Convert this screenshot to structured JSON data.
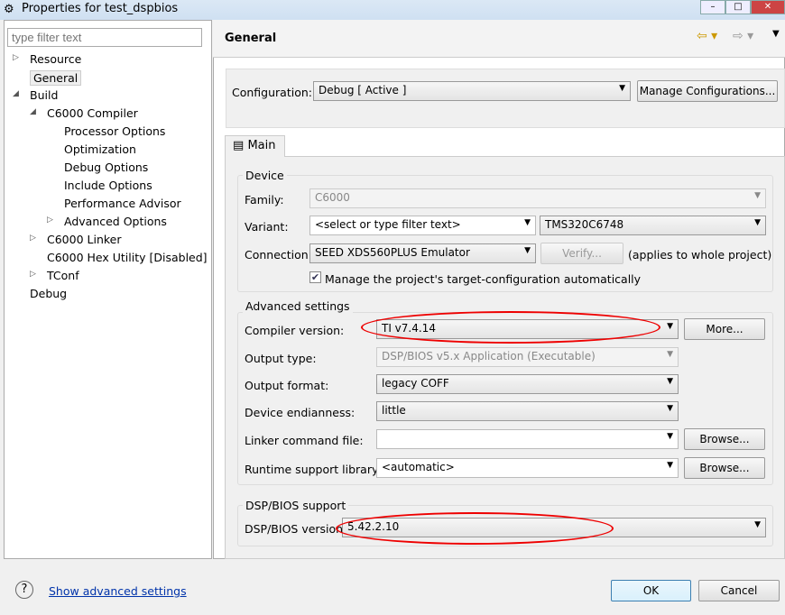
{
  "window": {
    "title": "Properties for test_dspbios"
  },
  "sidebar": {
    "filter_placeholder": "type filter text",
    "items": [
      {
        "label": "Resource",
        "level": 0,
        "expander": "collapsed"
      },
      {
        "label": "General",
        "level": 0,
        "selected": true
      },
      {
        "label": "Build",
        "level": 0,
        "expander": "expanded"
      },
      {
        "label": "C6000 Compiler",
        "level": 1,
        "expander": "expanded"
      },
      {
        "label": "Processor Options",
        "level": 2
      },
      {
        "label": "Optimization",
        "level": 2
      },
      {
        "label": "Debug Options",
        "level": 2
      },
      {
        "label": "Include Options",
        "level": 2
      },
      {
        "label": "Performance Advisor",
        "level": 2
      },
      {
        "label": "Advanced Options",
        "level": 2,
        "expander": "collapsed"
      },
      {
        "label": "C6000 Linker",
        "level": 1,
        "expander": "collapsed"
      },
      {
        "label": "C6000 Hex Utility  [Disabled]",
        "level": 1
      },
      {
        "label": "TConf",
        "level": 1,
        "expander": "collapsed"
      },
      {
        "label": "Debug",
        "level": 0
      }
    ]
  },
  "header": {
    "title": "General"
  },
  "config": {
    "label": "Configuration:",
    "value": "Debug  [ Active ]",
    "manage": "Manage Configurations..."
  },
  "tab": {
    "label": "Main"
  },
  "device": {
    "title": "Device",
    "family_label": "Family:",
    "family": "C6000",
    "variant_label": "Variant:",
    "variant_filter": "<select or type filter text>",
    "variant": "TMS320C6748",
    "connection_label": "Connection:",
    "connection": "SEED XDS560PLUS Emulator",
    "verify": "Verify...",
    "applies": "(applies to whole project)",
    "manage_check": "Manage the project's target-configuration automatically",
    "manage_checked": true
  },
  "advanced": {
    "title": "Advanced settings",
    "compiler_label": "Compiler version:",
    "compiler": "TI v7.4.14",
    "more": "More...",
    "output_type_label": "Output type:",
    "output_type": "DSP/BIOS v5.x Application (Executable)",
    "output_format_label": "Output format:",
    "output_format": "legacy COFF",
    "endian_label": "Device endianness:",
    "endian": "little",
    "linker_label": "Linker command file:",
    "linker": "",
    "browse": "Browse...",
    "rts_label": "Runtime support library:",
    "rts": "<automatic>"
  },
  "bios": {
    "title": "DSP/BIOS support",
    "label": "DSP/BIOS version:",
    "value": "5.42.2.10"
  },
  "footer": {
    "advanced_link": "Show advanced settings",
    "ok": "OK",
    "cancel": "Cancel"
  },
  "colors": {
    "highlight_oval": "#e00000",
    "link": "#0033aa"
  }
}
